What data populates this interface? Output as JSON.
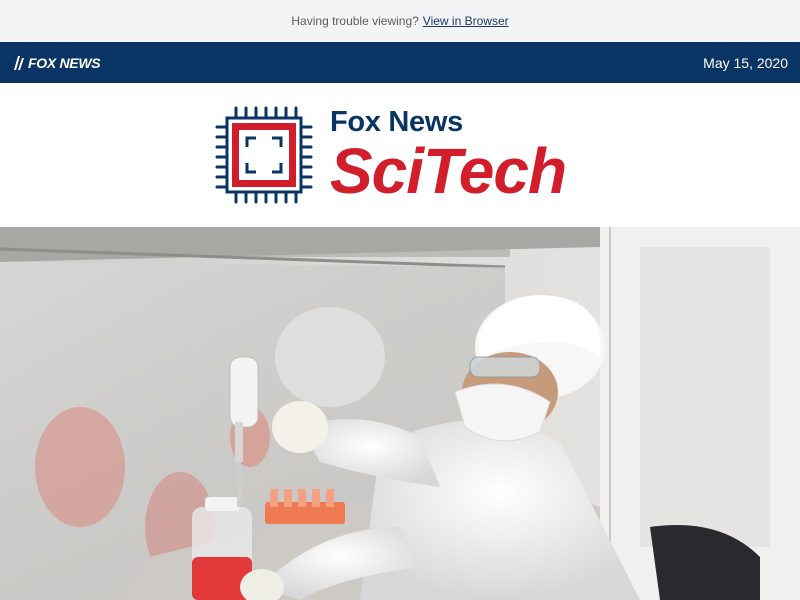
{
  "preheader": {
    "text": "Having trouble viewing?",
    "link_label": "View in Browser"
  },
  "navbar": {
    "brand": "FOX NEWS",
    "date": "May 15, 2020"
  },
  "masthead": {
    "line1": "Fox News",
    "line2": "SciTech"
  },
  "colors": {
    "navy": "#0a3463",
    "red": "#d21d2b",
    "preheader_bg": "#f3f4f6"
  },
  "icons": {
    "chip": "chip-icon",
    "brand": "fox-news-logo-icon"
  }
}
